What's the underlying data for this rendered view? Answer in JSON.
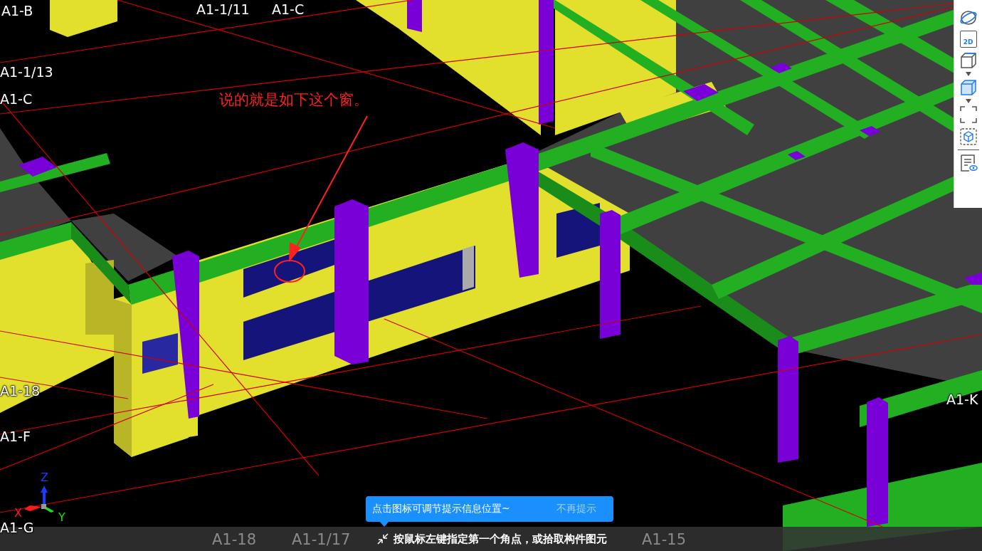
{
  "viewport": {
    "grid_labels": [
      {
        "text": "A1-B"
      },
      {
        "text": "A1-1/11"
      },
      {
        "text": "A1-C"
      },
      {
        "text": "A1-1/13"
      },
      {
        "text": "A1-C"
      },
      {
        "text": "A1-18"
      },
      {
        "text": "A1-F"
      },
      {
        "text": "A1-G"
      },
      {
        "text": "A1-K"
      }
    ],
    "annotation": {
      "text": "说的就是如下这个窗。"
    },
    "axis_gizmo": {
      "x": "X",
      "y": "Y",
      "z": "Z"
    }
  },
  "toolbar": {
    "items": [
      {
        "kind": "orbit"
      },
      {
        "kind": "text",
        "label": "2D"
      },
      {
        "kind": "cube"
      },
      {
        "kind": "caret"
      },
      {
        "kind": "cube-filled"
      },
      {
        "kind": "caret"
      },
      {
        "kind": "frame"
      },
      {
        "kind": "box-cube"
      },
      {
        "kind": "divider"
      },
      {
        "kind": "properties"
      }
    ]
  },
  "tooltip": {
    "message": "点击图标可调节提示信息位置~",
    "dismiss": "不再提示"
  },
  "status_bar": {
    "grid_labels": [
      {
        "text": "A1-18"
      },
      {
        "text": "A1-1/17"
      },
      {
        "text": "A1-15"
      }
    ],
    "prompt": "按鼠标左键指定第一个角点，或拾取构件图元"
  }
}
